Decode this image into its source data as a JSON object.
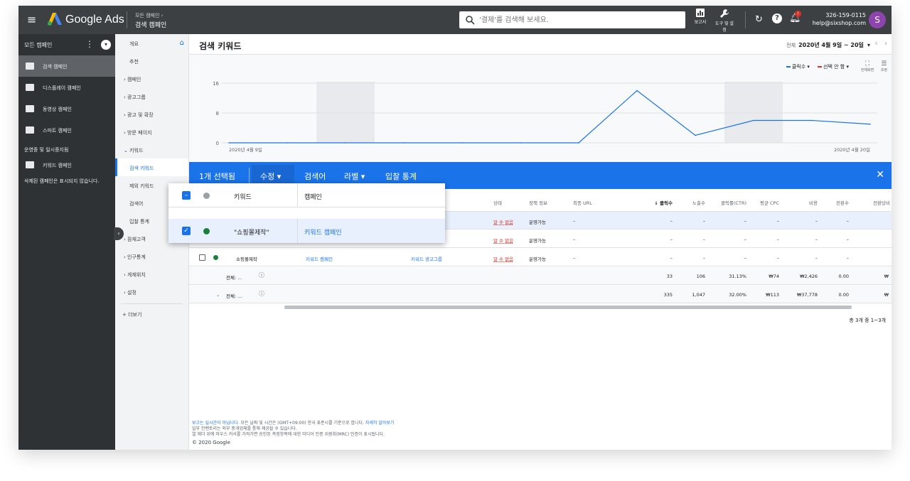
{
  "topbar": {
    "brand": "Google Ads",
    "breadcrumb_parent": "모든 캠페인 ›",
    "breadcrumb_current": "검색 캠페인",
    "search_placeholder": "'결제'를 검색해 보세요.",
    "reports_label": "보고서",
    "tools_label": "도구 및 설정",
    "account_id": "326-159-0115",
    "account_email": "help@sixshop.com",
    "avatar_letter": "S"
  },
  "leftnav": {
    "header": "모든 캠페인",
    "items": [
      {
        "label": "검색 캠페인",
        "active": true
      },
      {
        "label": "디스플레이 캠페인",
        "active": false
      },
      {
        "label": "동영상 캠페인",
        "active": false
      },
      {
        "label": "스마트 캠페인",
        "active": false
      }
    ],
    "section": "운영중 및 일시중지됨",
    "keyword_campaign": "키워드 캠페인",
    "removed_note": "삭제된 캠페인은 표시되지 않습니다."
  },
  "subnav": {
    "items": [
      {
        "label": "개요",
        "type": "plain"
      },
      {
        "label": "추천",
        "type": "plain"
      },
      {
        "label": "› 캠페인",
        "type": "caret"
      },
      {
        "label": "› 광고그룹",
        "type": "caret"
      },
      {
        "label": "› 광고 및 확장",
        "type": "caret"
      },
      {
        "label": "› 방문 페이지",
        "type": "caret"
      },
      {
        "label": "⌄ 키워드",
        "type": "caret"
      },
      {
        "label": "검색 키워드",
        "type": "active"
      },
      {
        "label": "제외 키워드",
        "type": "plain"
      },
      {
        "label": "검색어",
        "type": "plain"
      },
      {
        "label": "입찰 통계",
        "type": "plain"
      },
      {
        "label": "› 잠재고객",
        "type": "caret"
      },
      {
        "label": "› 인구통계",
        "type": "caret"
      },
      {
        "label": "› 게재위치",
        "type": "caret"
      },
      {
        "label": "› 설정",
        "type": "caret"
      }
    ],
    "more": "+ 더보기"
  },
  "main": {
    "title": "검색 키워드",
    "date_label": "전체",
    "date_range": "2020년 4월 9일 ~ 20일",
    "legend_1": "클릭수",
    "legend_2": "선택 안 함",
    "fullscreen_label": "전체화면",
    "adjust_label": "조정",
    "footnote_link": "보고는 실시간이 아닙니다.",
    "footnote_1": "모든 날짜 및 시간은 (GMT+09:00) 한국 표준시를 기준으로 합니다.",
    "footnote_more": "자세히 알아보기",
    "footnote_2": "일부 인벤토리는 외부 중개업체를 통해 제공될 수 있습니다.",
    "footnote_3": "열 헤더 위에 마우스 커서를 가져가면 승인된 측정항목에 대한 미디어 인증 위원회(MRC) 인증이 표시됩니다.",
    "copyright": "© 2020 Google",
    "pager": "총 3개 중 1~3개"
  },
  "chart_data": {
    "type": "line",
    "x_labels": [
      "2020년 4월 9일",
      "2020년 4월 20일"
    ],
    "y_ticks": [
      "0",
      "8",
      "16"
    ],
    "ylim": [
      0,
      16
    ],
    "x": [
      0,
      1,
      2,
      3,
      4,
      5,
      6,
      7,
      8,
      9,
      10,
      11
    ],
    "series": [
      {
        "name": "클릭수",
        "values": [
          0,
          0,
          0,
          0,
          0,
          0,
          0,
          14,
          2,
          6,
          6,
          5
        ]
      }
    ],
    "shaded_days": [
      2,
      9
    ]
  },
  "selection": {
    "count": "1개 선택됨",
    "edit": "수정",
    "search_terms": "검색어",
    "label": "라벨",
    "bid": "입찰 통계"
  },
  "panel": {
    "col_keyword": "키워드",
    "col_campaign": "캠페인",
    "row_keyword": "\"쇼핑몰제작\"",
    "row_campaign": "키워드 캠페인"
  },
  "table": {
    "headers": [
      "상태",
      "정책 정보",
      "최종 URL",
      "↓ 클릭수",
      "노출수",
      "클릭률(CTR)",
      "평균 CPC",
      "비용",
      "전환수",
      "전환당비"
    ],
    "rows": [
      {
        "status": "알 수 없음",
        "policy": "운영가능",
        "url": "–",
        "vals": [
          "–",
          "–",
          "–",
          "–",
          "–",
          "–"
        ]
      },
      {
        "status": "알 수 없음",
        "policy": "운영가능",
        "url": "–",
        "vals": [
          "–",
          "–",
          "–",
          "–",
          "–",
          "–"
        ]
      },
      {
        "keyword": "쇼핑몰제작",
        "campaign": "키워드 캠페인",
        "adgroup": "키워드 광고그룹",
        "status": "알 수 없음",
        "policy": "운영가능",
        "url": "–",
        "vals": [
          "–",
          "–",
          "–",
          "–",
          "–",
          "–"
        ]
      }
    ],
    "total1": {
      "label": "전체: ...",
      "vals": [
        "33",
        "106",
        "31.13%",
        "₩74",
        "₩2,426",
        "0.00",
        "₩"
      ]
    },
    "total2": {
      "label": "전체: ...",
      "vals": [
        "335",
        "1,047",
        "32.00%",
        "₩113",
        "₩37,778",
        "0.00",
        "₩"
      ]
    }
  },
  "colors": {
    "accent": "#1a73e8",
    "series1": "#1a73e8",
    "legend2": "#d93025"
  }
}
